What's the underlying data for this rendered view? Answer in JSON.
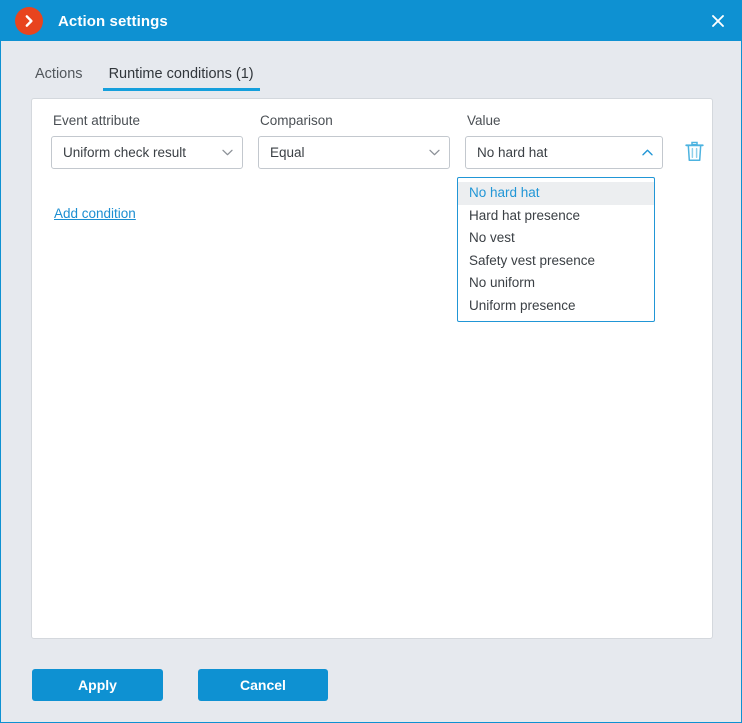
{
  "window": {
    "title": "Action settings",
    "logo_icon": "chevron-right-circle-icon",
    "close_icon": "close-icon",
    "accent_color": "#0e91d2",
    "logo_color": "#e8441e"
  },
  "tabs": [
    {
      "label": "Actions",
      "active": false
    },
    {
      "label": "Runtime conditions (1)",
      "active": true
    }
  ],
  "condition": {
    "attribute": {
      "label": "Event attribute",
      "value": "Uniform check result",
      "chevron_icon": "chevron-down-icon"
    },
    "comparison": {
      "label": "Comparison",
      "value": "Equal",
      "chevron_icon": "chevron-down-icon"
    },
    "value": {
      "label": "Value",
      "value": "No hard hat",
      "chevron_icon": "chevron-up-icon",
      "expanded": true,
      "options": [
        "No hard hat",
        "Hard hat presence",
        "No vest",
        "Safety vest presence",
        "No uniform",
        "Uniform presence"
      ],
      "selected_index": 0
    },
    "delete_icon": "trash-icon"
  },
  "add_condition_link": "Add condition",
  "footer": {
    "apply_label": "Apply",
    "cancel_label": "Cancel"
  }
}
